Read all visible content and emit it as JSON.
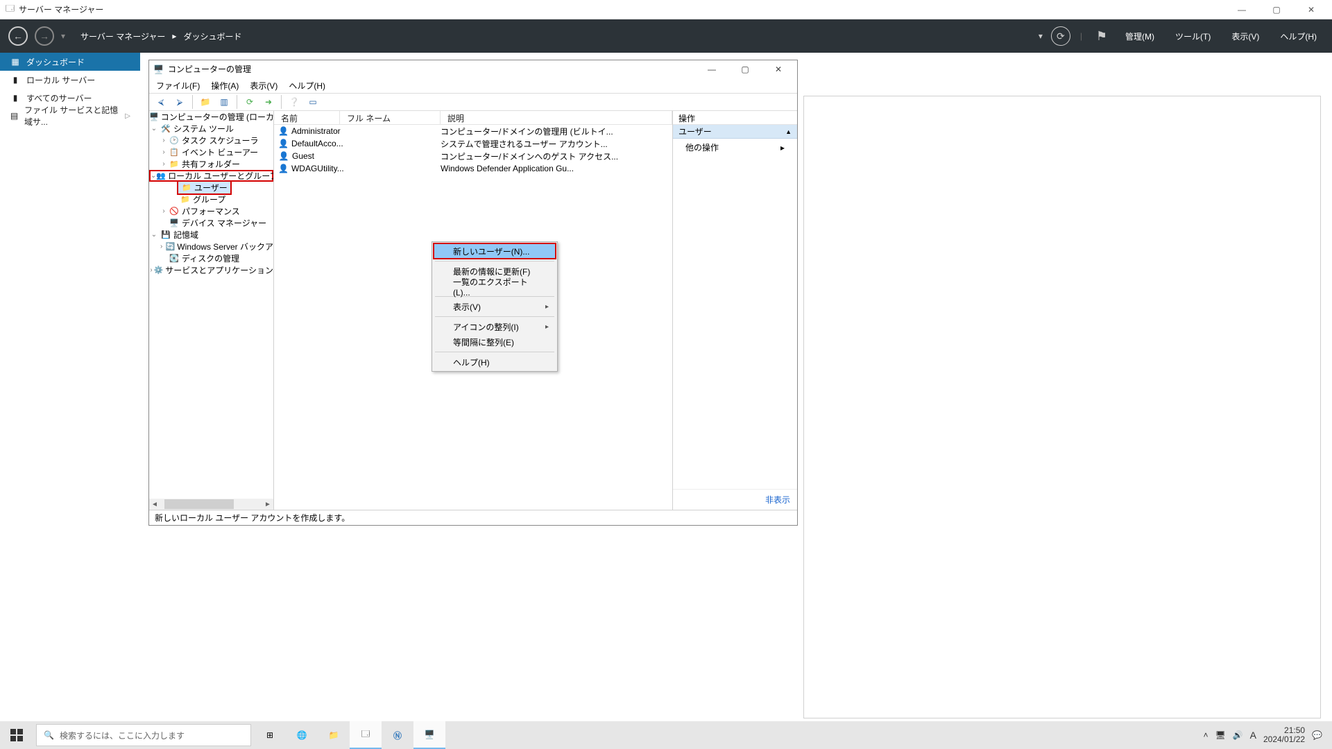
{
  "serverManager": {
    "windowTitle": "サーバー マネージャー",
    "breadcrumb1": "サーバー マネージャー",
    "breadcrumb2": "ダッシュボード",
    "menus": {
      "manage": "管理(M)",
      "tools": "ツール(T)",
      "view": "表示(V)",
      "help": "ヘルプ(H)"
    },
    "sidebar": {
      "dashboard": "ダッシュボード",
      "localServer": "ローカル サーバー",
      "allServers": "すべてのサーバー",
      "fileServices": "ファイル サービスと記憶域サ..."
    }
  },
  "mmc": {
    "title": "コンピューターの管理",
    "menus": {
      "file": "ファイル(F)",
      "action": "操作(A)",
      "view": "表示(V)",
      "help": "ヘルプ(H)"
    },
    "tree": {
      "root": "コンピューターの管理 (ローカル)",
      "sysTools": "システム ツール",
      "taskSched": "タスク スケジューラ",
      "eventViewer": "イベント ビューアー",
      "sharedFolders": "共有フォルダー",
      "localUsersGroups": "ローカル ユーザーとグループ",
      "users": "ユーザー",
      "groups": "グループ",
      "performance": "パフォーマンス",
      "deviceMgr": "デバイス マネージャー",
      "storage": "記憶域",
      "wsBackup": "Windows Server バックア",
      "diskMgmt": "ディスクの管理",
      "servicesApps": "サービスとアプリケーション"
    },
    "columns": {
      "name": "名前",
      "fullName": "フル ネーム",
      "desc": "説明"
    },
    "rows": [
      {
        "name": "Administrator",
        "full": "",
        "desc": "コンピューター/ドメインの管理用 (ビルトイ..."
      },
      {
        "name": "DefaultAcco...",
        "full": "",
        "desc": "システムで管理されるユーザー アカウント..."
      },
      {
        "name": "Guest",
        "full": "",
        "desc": "コンピューター/ドメインへのゲスト アクセス..."
      },
      {
        "name": "WDAGUtility...",
        "full": "",
        "desc": "Windows Defender Application Gu..."
      }
    ],
    "actions": {
      "header": "操作",
      "section": "ユーザー",
      "other": "他の操作",
      "hide": "非表示"
    },
    "status": "新しいローカル ユーザー アカウントを作成します。"
  },
  "contextMenu": {
    "newUser": "新しいユーザー(N)...",
    "refresh": "最新の情報に更新(F)",
    "exportList": "一覧のエクスポート(L)...",
    "view": "表示(V)",
    "arrangeIcons": "アイコンの整列(I)",
    "lineUp": "等間隔に整列(E)",
    "help": "ヘルプ(H)"
  },
  "taskbar": {
    "searchPlaceholder": "検索するには、ここに入力します",
    "ime": "A",
    "time": "21:50",
    "date": "2024/01/22"
  }
}
